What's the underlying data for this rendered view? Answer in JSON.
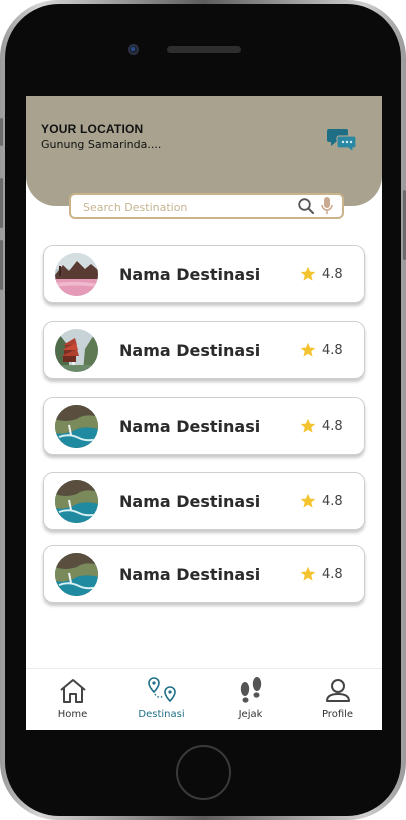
{
  "header": {
    "location_label": "YOUR LOCATION",
    "location_value": "Gunung Samarinda....",
    "chat_icon": "chat-bubbles-icon"
  },
  "search": {
    "placeholder": "Search Destination",
    "search_icon": "search-icon",
    "mic_icon": "microphone-icon"
  },
  "destinations": [
    {
      "name": "Nama Destinasi",
      "rating": "4.8",
      "thumb": "pink-lake-landscape"
    },
    {
      "name": "Nama Destinasi",
      "rating": "4.8",
      "thumb": "waterfall-pagoda"
    },
    {
      "name": "Nama Destinasi",
      "rating": "4.8",
      "thumb": "coastal-cliff-waterfall"
    },
    {
      "name": "Nama Destinasi",
      "rating": "4.8",
      "thumb": "coastal-cliff-waterfall"
    },
    {
      "name": "Nama Destinasi",
      "rating": "4.8",
      "thumb": "coastal-cliff-waterfall"
    }
  ],
  "tabs": [
    {
      "label": "Home",
      "icon": "home-icon",
      "active": false
    },
    {
      "label": "Destinasi",
      "icon": "map-pin-route-icon",
      "active": true
    },
    {
      "label": "Jejak",
      "icon": "footprints-icon",
      "active": false
    },
    {
      "label": "Profile",
      "icon": "profile-icon",
      "active": false
    }
  ],
  "colors": {
    "header_bg": "#a8a28f",
    "search_border": "#c9b48a",
    "accent": "#1e6f86",
    "star": "#f4c430"
  }
}
